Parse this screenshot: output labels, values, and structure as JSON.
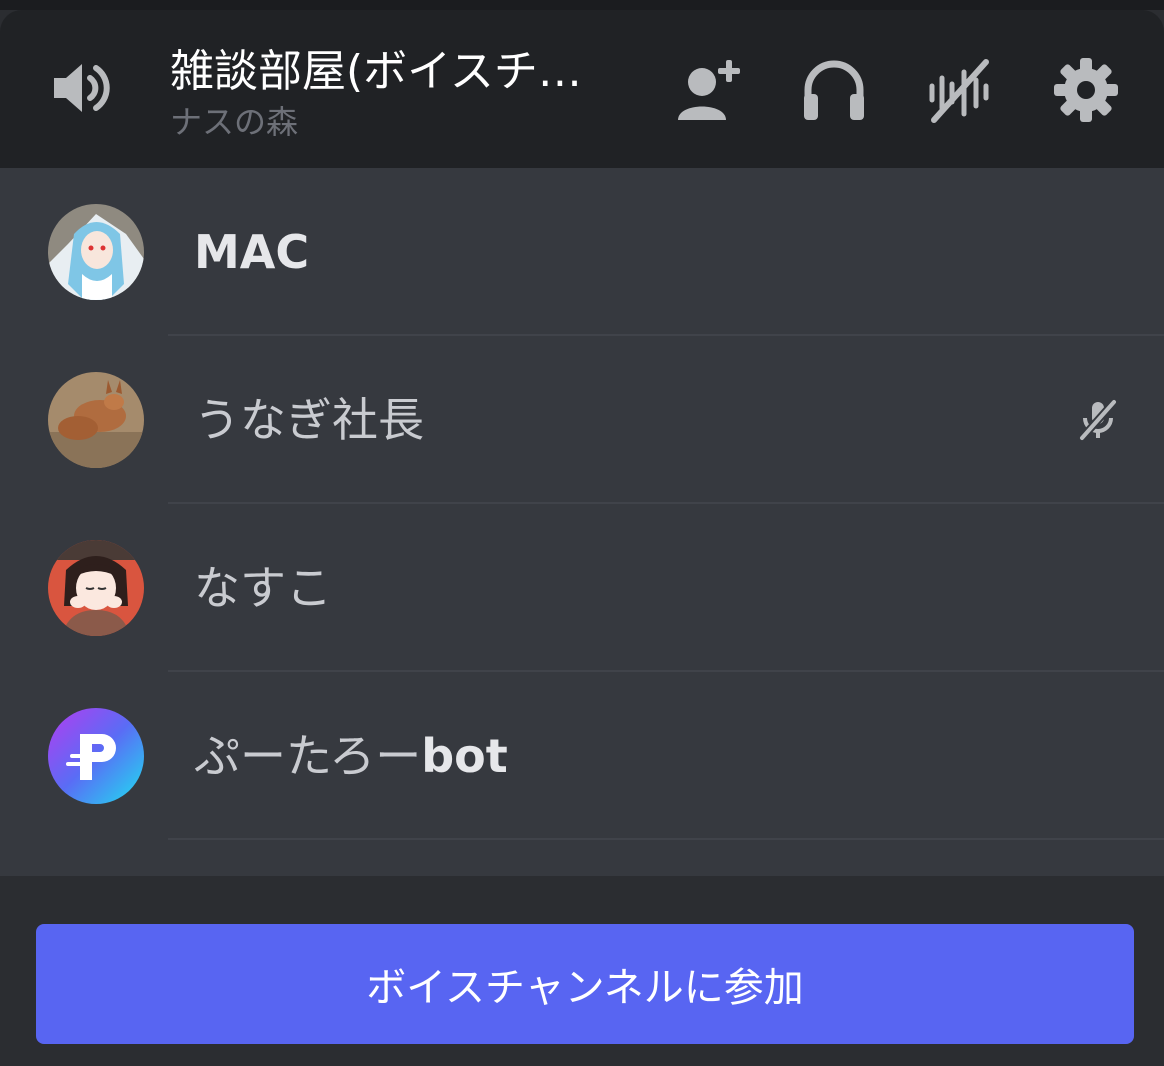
{
  "channel": {
    "title": "雑談部屋(ボイスチ…",
    "server": "ナスの森"
  },
  "header_icons": [
    "speaker-icon",
    "add-friend-icon",
    "headphones-icon",
    "noise-suppression-icon",
    "settings-icon"
  ],
  "members": [
    {
      "name": "MAC",
      "avatar": "avatar-anime-girl",
      "muted": false,
      "bold": true
    },
    {
      "name": "うなぎ社長",
      "avatar": "avatar-kangaroo",
      "muted": true,
      "bold": false
    },
    {
      "name": "なすこ",
      "avatar": "avatar-girl-drawing",
      "muted": false,
      "bold": false
    },
    {
      "name": "ぷーたろー",
      "name_suffix": "bot",
      "avatar": "avatar-p-logo",
      "muted": false,
      "bold": false
    }
  ],
  "join_button": {
    "label": "ボイスチャンネルに参加"
  },
  "colors": {
    "header_bg": "#202225",
    "list_bg": "#36393f",
    "footer_bg": "#2b2d31",
    "accent": "#5865f2",
    "icon": "#b9bbbe"
  }
}
